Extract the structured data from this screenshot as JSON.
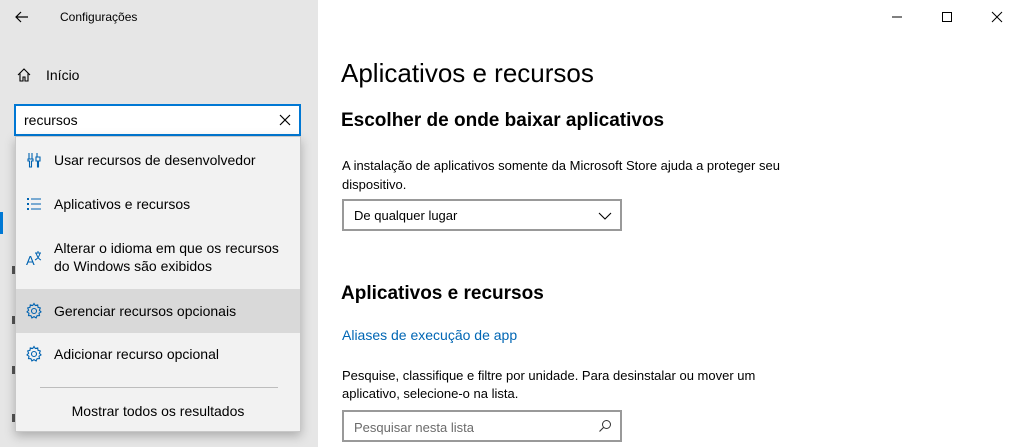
{
  "window": {
    "title": "Configurações",
    "controls": {
      "minimize": "minimize-icon",
      "maximize": "maximize-icon",
      "close": "close-icon"
    }
  },
  "sidebar": {
    "home_label": "Início",
    "search": {
      "value": "recursos",
      "placeholder": ""
    },
    "suggestions": [
      {
        "label": "Usar recursos de desenvolvedor",
        "icon": "developer-tools-icon"
      },
      {
        "label": "Aplicativos e recursos",
        "icon": "apps-list-icon"
      },
      {
        "label": "Alterar o idioma em que os recursos do Windows são exibidos",
        "icon": "language-icon"
      },
      {
        "label": "Gerenciar recursos opcionais",
        "icon": "gear-icon",
        "selected": true
      },
      {
        "label": "Adicionar recurso opcional",
        "icon": "gear-icon"
      }
    ],
    "show_all": "Mostrar todos os resultados"
  },
  "main": {
    "title": "Aplicativos e recursos",
    "section1": {
      "heading": "Escolher de onde baixar aplicativos",
      "description": "A instalação de aplicativos somente da Microsoft Store ajuda a proteger seu dispositivo.",
      "select_value": "De qualquer lugar"
    },
    "section2": {
      "heading": "Aplicativos e recursos",
      "link": "Aliases de execução de app",
      "description": "Pesquise, classifique e filtre por unidade. Para desinstalar ou mover um aplicativo, selecione-o na lista.",
      "search_placeholder": "Pesquisar nesta lista"
    }
  },
  "colors": {
    "accent": "#0078d4",
    "link": "#0066b4",
    "sidebar_bg": "#e6e6e6"
  }
}
